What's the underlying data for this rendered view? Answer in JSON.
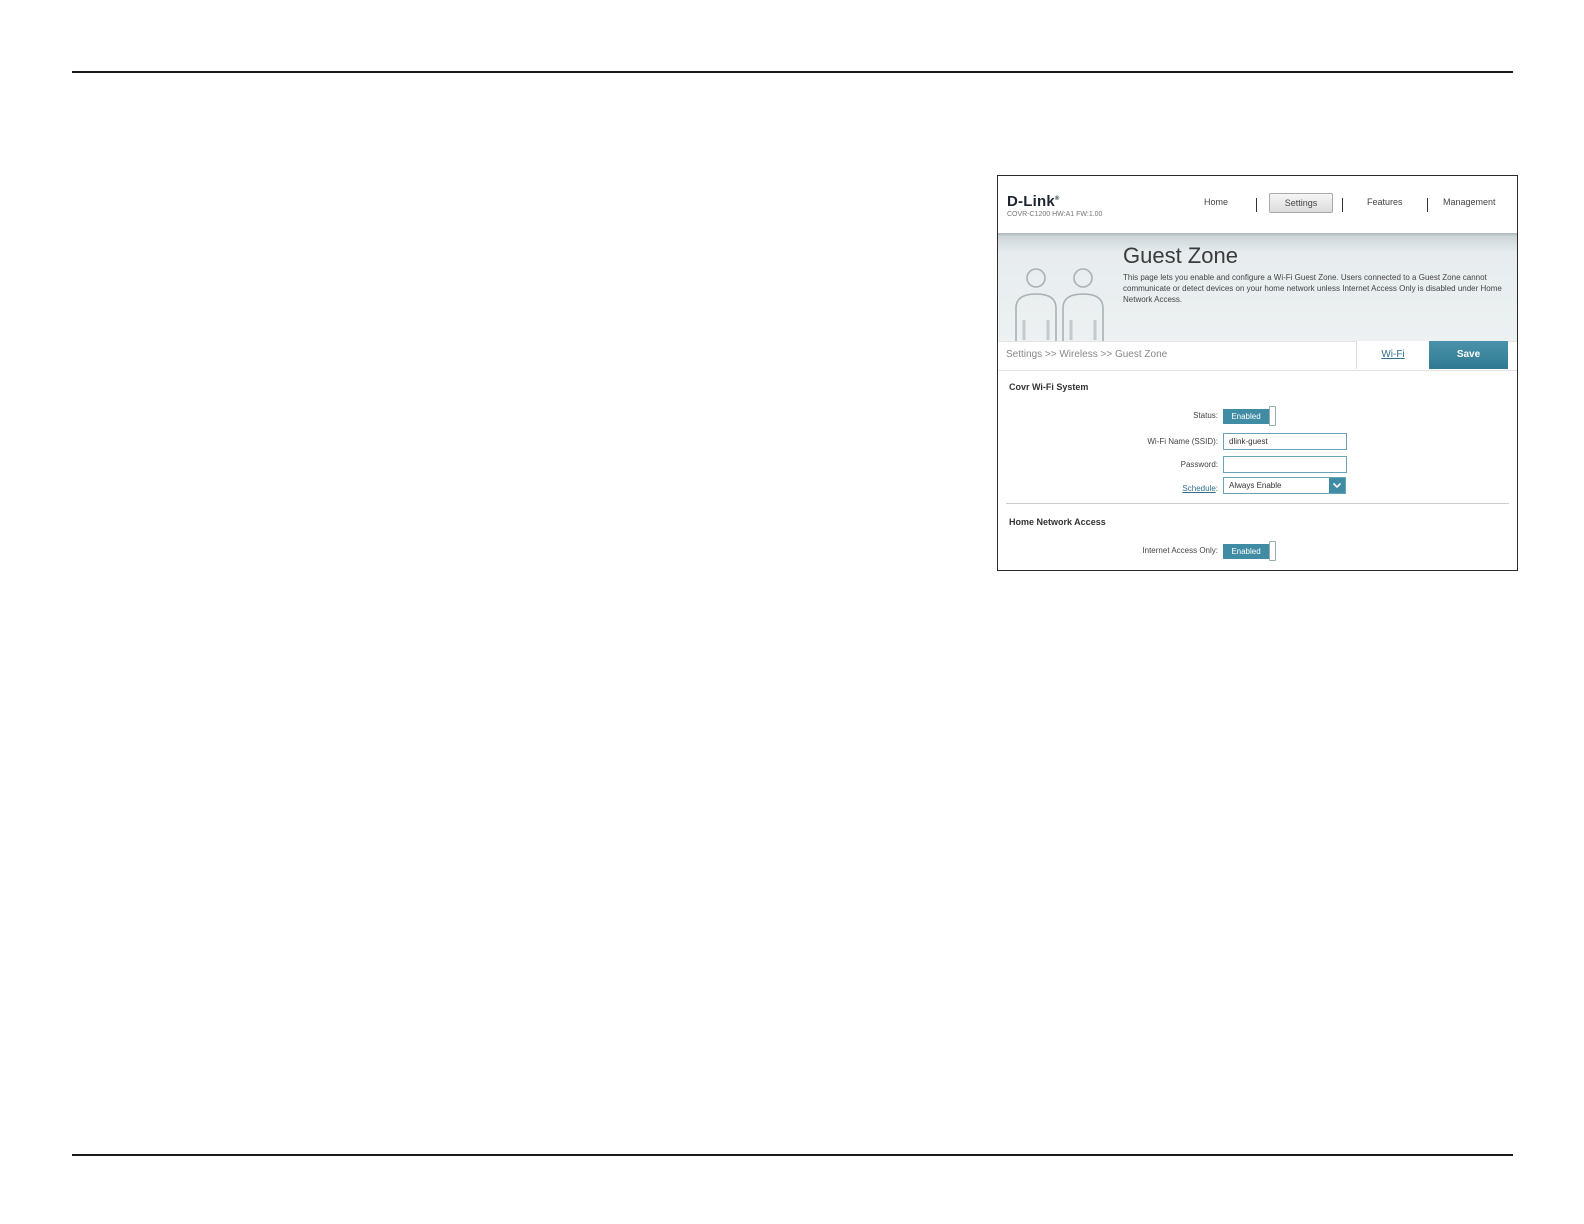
{
  "router_ui": {
    "brand": "D-Link",
    "model_info": "COVR-C1200 HW:A1 FW:1.00",
    "nav": {
      "home": "Home",
      "settings": "Settings",
      "features": "Features",
      "management": "Management",
      "active": "Settings"
    },
    "page": {
      "title": "Guest Zone",
      "description": "This page lets you enable and configure a Wi-Fi Guest Zone. Users connected to a Guest Zone cannot communicate or detect devices on your home network unless Internet Access Only is disabled under Home Network Access."
    },
    "breadcrumb": "Settings >> Wireless >> Guest Zone",
    "wifi_link": "Wi-Fi",
    "save_label": "Save",
    "covr_section": {
      "title": "Covr Wi-Fi System",
      "status_label": "Status:",
      "status_value": "Enabled",
      "ssid_label": "Wi-Fi Name (SSID):",
      "ssid_value": "dlink-guest",
      "password_label": "Password:",
      "password_value": "",
      "schedule_label": "Schedule",
      "schedule_value": "Always Enable"
    },
    "home_network_section": {
      "title": "Home Network Access",
      "internet_only_label": "Internet Access Only:",
      "internet_only_value": "Enabled"
    },
    "colors": {
      "accent": "#3f8ca4",
      "link": "#2f6f8a"
    }
  }
}
